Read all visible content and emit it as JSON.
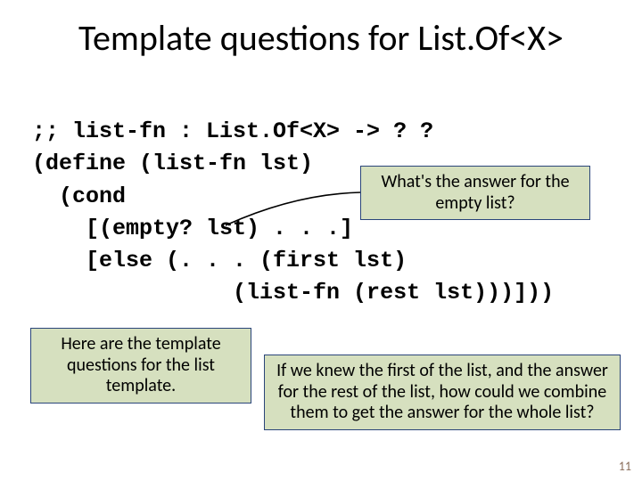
{
  "title": "Template questions for List.Of<X>",
  "code": ";; list-fn : List.Of<X> -> ? ?\n(define (list-fn lst)\n  (cond\n    [(empty? lst) . . .]\n    [else (. . . (first lst)\n               (list-fn (rest lst)))]))",
  "callouts": {
    "c1": "What's the answer for\nthe empty list?",
    "c2": "Here are the template\nquestions for the list\ntemplate.",
    "c3": "If we knew the first of the list, and\nthe answer for the rest of the list,\nhow could we combine them to get\nthe answer for the whole list?"
  },
  "page": "11"
}
